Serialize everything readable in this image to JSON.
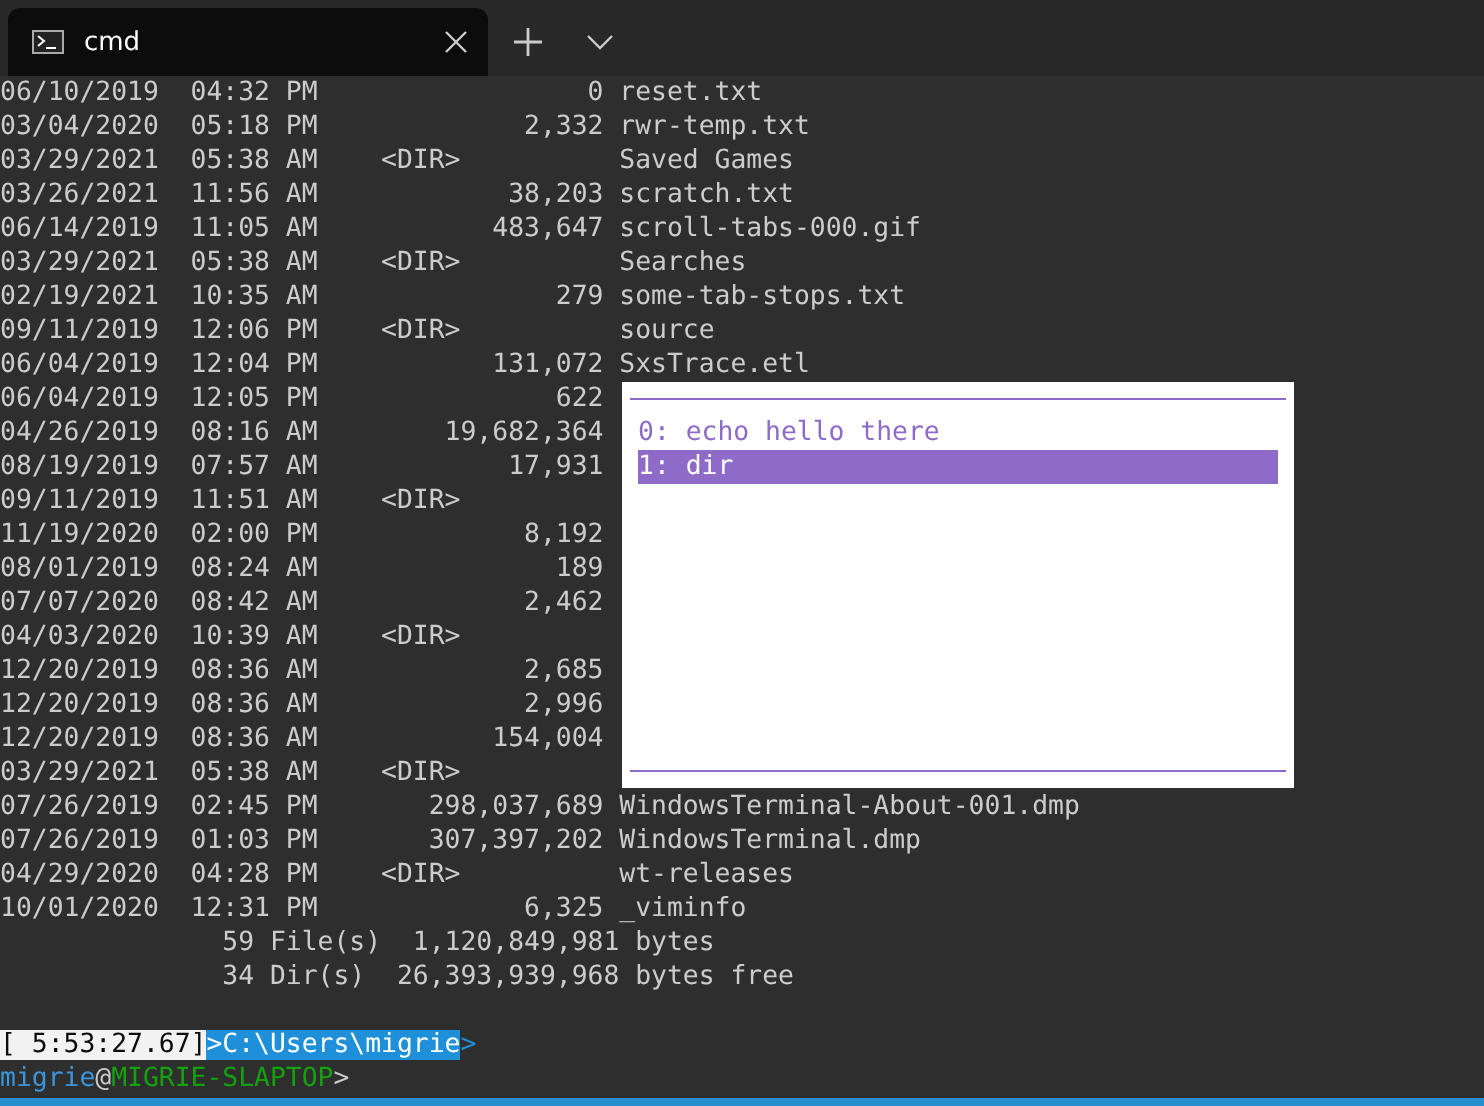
{
  "tab": {
    "title": "cmd"
  },
  "lines": [
    "06/10/2019  04:32 PM                 0 reset.txt",
    "03/04/2020  05:18 PM             2,332 rwr-temp.txt",
    "03/29/2021  05:38 AM    <DIR>          Saved Games",
    "03/26/2021  11:56 AM            38,203 scratch.txt",
    "06/14/2019  11:05 AM           483,647 scroll-tabs-000.gif",
    "03/29/2021  05:38 AM    <DIR>          Searches",
    "02/19/2021  10:35 AM               279 some-tab-stops.txt",
    "09/11/2019  12:06 PM    <DIR>          source",
    "06/04/2019  12:04 PM           131,072 SxsTrace.etl",
    "06/04/2019  12:05 PM               622",
    "04/26/2019  08:16 AM        19,682,364",
    "08/19/2019  07:57 AM            17,931",
    "09/11/2019  11:51 AM    <DIR>",
    "11/19/2020  02:00 PM             8,192",
    "08/01/2019  08:24 AM               189",
    "07/07/2020  08:42 AM             2,462",
    "04/03/2020  10:39 AM    <DIR>",
    "12/20/2019  08:36 AM             2,685",
    "12/20/2019  08:36 AM             2,996",
    "12/20/2019  08:36 AM           154,004",
    "03/29/2021  05:38 AM    <DIR>",
    "07/26/2019  02:45 PM       298,037,689 WindowsTerminal-About-001.dmp",
    "07/26/2019  01:03 PM       307,397,202 WindowsTerminal.dmp",
    "04/29/2020  04:28 PM    <DIR>          wt-releases",
    "10/01/2020  12:31 PM             6,325 _viminfo",
    "              59 File(s)  1,120,849,981 bytes",
    "              34 Dir(s)  26,393,939,968 bytes free"
  ],
  "prompt": [
    {
      "segments": [
        {
          "text": "[ 5:53:27.67]",
          "kind": "inverse"
        },
        {
          "text": ">C:\\Users\\migrie",
          "kind": "highlight"
        },
        {
          "text": ">",
          "kind": "plain",
          "color": "#1e8fd8"
        }
      ]
    },
    {
      "segments": [
        {
          "text": "migrie",
          "kind": "plain",
          "color": "#3a96dd"
        },
        {
          "text": "@",
          "kind": "plain",
          "color": "#cccccc"
        },
        {
          "text": "MIGRIE-SLAPTOP",
          "kind": "plain",
          "color": "#13a10e"
        },
        {
          "text": ">",
          "kind": "plain",
          "color": "#cccccc"
        }
      ]
    }
  ],
  "popup": {
    "items": [
      {
        "text": "0: echo hello there",
        "selected": false
      },
      {
        "text": "1: dir",
        "selected": true
      }
    ]
  }
}
